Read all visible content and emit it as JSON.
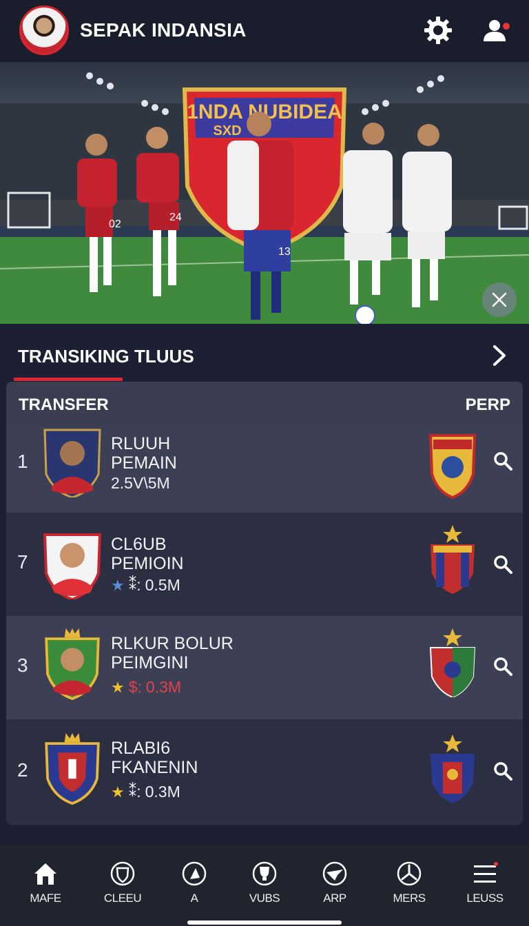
{
  "header": {
    "title": "SEPAK INDANSIA",
    "icons": [
      "gear-icon",
      "user-icon"
    ],
    "notification_color": "#e8353c"
  },
  "hero": {
    "crest_text_top": "1NDA NUBIDEA",
    "crest_text_sub": "SXD",
    "jersey_numbers": [
      "02",
      "24",
      "13"
    ]
  },
  "section": {
    "title": "TRANSIKING TLUUS",
    "accent": "#d9262f"
  },
  "table": {
    "col_left": "TRANSFER",
    "col_right": "PERP",
    "rows": [
      {
        "rank": "1",
        "name_line1": "RLUUH",
        "name_line2": "PEMAIN",
        "value": "2.5V\\5M",
        "star": false,
        "value_prefix": ""
      },
      {
        "rank": "7",
        "name_line1": "CL6UB",
        "name_line2": "PEMIOIN",
        "value": "0.5M",
        "star": true,
        "star_color": "#5b8bd6",
        "value_prefix": "⁑:"
      },
      {
        "rank": "3",
        "name_line1": "RLKUR BOLUR",
        "name_line2": "PEIMGINI",
        "value": "0.3M",
        "star": true,
        "star_color": "#f0c22a",
        "value_prefix": "$:",
        "value_color": "red"
      },
      {
        "rank": "2",
        "name_line1": "RLABI6",
        "name_line2": "FKANENIN",
        "value": "0.3M",
        "star": true,
        "star_color": "#f0c22a",
        "value_prefix": "⁑:"
      }
    ]
  },
  "nav": {
    "items": [
      {
        "label": "MAFE",
        "icon": "home-icon"
      },
      {
        "label": "CLEEU",
        "icon": "shield-icon"
      },
      {
        "label": "A",
        "icon": "ball-icon"
      },
      {
        "label": "VUBS",
        "icon": "trophy-icon"
      },
      {
        "label": "ARP",
        "icon": "transfer-icon"
      },
      {
        "label": "MERS",
        "icon": "clock-icon"
      },
      {
        "label": "LEUSS",
        "icon": "menu-icon"
      }
    ]
  }
}
